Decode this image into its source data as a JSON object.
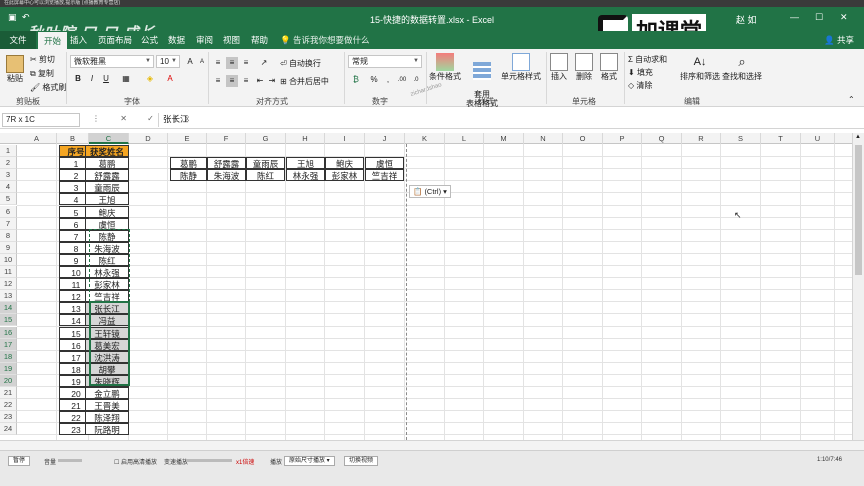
{
  "player_top": {
    "caption": "在此屏幕中心可以浏览播放,提示版 (点播教育专营店)"
  },
  "title_bar": {
    "doc_title": "15-快捷的数据转置.xlsx - Excel",
    "user": "赵 如",
    "watermark": "秋叶院 口 口 成长",
    "logo_text": "加课堂",
    "min": "—",
    "max": "☐",
    "close": "✕"
  },
  "tabs": [
    "开始",
    "插入",
    "页面布局",
    "公式",
    "数据",
    "审阅",
    "视图",
    "帮助"
  ],
  "file_tab": "文件",
  "tell_me": "告诉我你想要做什么",
  "share": "共享",
  "ribbon": {
    "clipboard": {
      "paste": "粘贴",
      "cut": "剪切",
      "copy": "复制",
      "format_painter": "格式刷",
      "label": "剪贴板"
    },
    "font": {
      "name": "微软雅黑",
      "size": "10",
      "bold": "B",
      "italic": "I",
      "underline": "U",
      "label": "字体"
    },
    "align": {
      "wrap": "自动换行",
      "merge": "合并后居中",
      "label": "对齐方式"
    },
    "number": {
      "format": "常规",
      "percent": "%",
      "comma": ",",
      "label": "数字"
    },
    "styles": {
      "conditional": "条件格式",
      "table": "套用\n表格格式",
      "cell_styles": "单元格样式",
      "label": "样式"
    },
    "cells": {
      "insert": "插入",
      "delete": "删除",
      "format": "格式",
      "label": "单元格"
    },
    "editing": {
      "autosum": "自动求和",
      "fill": "填充",
      "clear": "清除",
      "sort": "排序和筛选",
      "find": "查找和选择",
      "label": "编辑"
    },
    "watermark_text": "zichardshao"
  },
  "formula_bar": {
    "name_box": "7R x 1C",
    "icons": "⋮ ✕ ✓ fx",
    "value": "张长江"
  },
  "columns": [
    "A",
    "B",
    "C",
    "D",
    "E",
    "F",
    "G",
    "H",
    "I",
    "J",
    "K",
    "L",
    "M",
    "N",
    "O",
    "P",
    "Q",
    "R",
    "S",
    "T",
    "U"
  ],
  "rows": [
    "1",
    "2",
    "3",
    "4",
    "5",
    "6",
    "7",
    "8",
    "9",
    "10",
    "11",
    "12",
    "13",
    "14",
    "15",
    "16",
    "17",
    "18",
    "19",
    "20",
    "21",
    "22",
    "23",
    "24"
  ],
  "table": {
    "headers": [
      "序号",
      "获奖姓名"
    ],
    "data": [
      [
        "1",
        "葛鹏"
      ],
      [
        "2",
        "舒露露"
      ],
      [
        "3",
        "童雨辰"
      ],
      [
        "4",
        "王旭"
      ],
      [
        "5",
        "鲍庆"
      ],
      [
        "6",
        "虞恒"
      ],
      [
        "7",
        "陈静"
      ],
      [
        "8",
        "朱海波"
      ],
      [
        "9",
        "陈红"
      ],
      [
        "10",
        "林永强"
      ],
      [
        "11",
        "彭家林"
      ],
      [
        "12",
        "竺吉祥"
      ],
      [
        "13",
        "张长江"
      ],
      [
        "14",
        "冯益"
      ],
      [
        "15",
        "王轩镜"
      ],
      [
        "16",
        "葛美宏"
      ],
      [
        "17",
        "沈洪涛"
      ],
      [
        "18",
        "胡攀"
      ],
      [
        "19",
        "朱晓辉"
      ],
      [
        "20",
        "金立鹏"
      ],
      [
        "21",
        "王晋美"
      ],
      [
        "22",
        "陈泽翔"
      ],
      [
        "23",
        "阮路明"
      ]
    ]
  },
  "transposed": [
    [
      "葛鹏",
      "舒露露",
      "童雨辰",
      "王旭",
      "鲍庆",
      "虞恒"
    ],
    [
      "陈静",
      "朱海波",
      "陈红",
      "林永强",
      "彭家林",
      "竺吉祥"
    ]
  ],
  "paste_ctrl": "(Ctrl) ▾",
  "player": {
    "pause": "暂停",
    "volume": "音量",
    "hq": "启用高清播放",
    "speed": "变速播放",
    "speed_val": "x1倍速",
    "size_label": "播放",
    "size_value": "原始尺寸播放",
    "switch": "切换视频",
    "time": "1:10/7:46"
  }
}
